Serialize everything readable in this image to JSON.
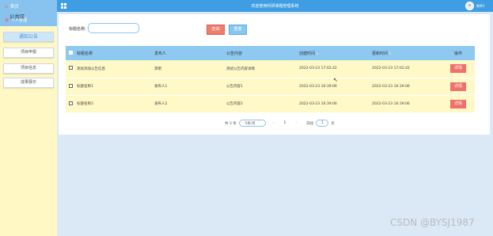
{
  "app": {
    "title": "欢迎使用科研课题管理系统",
    "username": "教师1"
  },
  "sidebar": {
    "home": "首页",
    "overlap_text": "公共区",
    "personal": "个人管理",
    "items": [
      {
        "label": "通知公告",
        "active": true
      },
      {
        "label": "项目申报",
        "active": false
      },
      {
        "label": "项目信息",
        "active": false
      },
      {
        "label": "成果展示",
        "active": false
      }
    ]
  },
  "search": {
    "label": "标题名称:",
    "value": "",
    "query_label": "查询",
    "reset_label": "重置"
  },
  "table": {
    "headers": [
      "标题名称",
      "发布人",
      "公告内容",
      "创建时间",
      "更新时间",
      "操作"
    ],
    "rows": [
      [
        "测试添加公告信息",
        "李明",
        "测试公告内容详情",
        "2022-03-23 17:02:42",
        "2022-03-23 17:02:42",
        "详情"
      ],
      [
        "标题名称1",
        "发布人1",
        "公告内容1",
        "2022-03-23 16:39:06",
        "2022-03-23 16:39:06",
        "详情"
      ],
      [
        "标题名称2",
        "发布人2",
        "公告内容2",
        "2022-03-23 16:39:06",
        "2022-03-23 16:39:06",
        "详情"
      ]
    ]
  },
  "pager": {
    "total": "共 3 条",
    "page_size": "5条/页",
    "prev": "‹",
    "current": "1",
    "next": "›",
    "goto_label": "前往",
    "goto_value": "1",
    "page_unit": "页"
  },
  "watermark": "CSDN @BYSJ1987",
  "colors": {
    "topbar": "#3f9ee3",
    "sidebar": "#fff8c4",
    "table_header": "#8ec9f2",
    "row_bg": "#fff9c8",
    "detail_btn": "#f0706a"
  }
}
